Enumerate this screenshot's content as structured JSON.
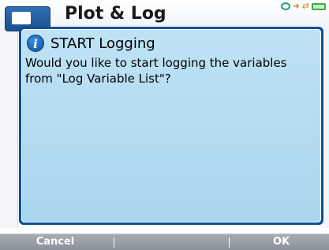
{
  "background": {
    "app_title": "Plot & Log"
  },
  "status_bar": {
    "icons": [
      "usb-connection-icon",
      "transfer-arrow-icon",
      "network-icon",
      "battery-icon"
    ]
  },
  "dialog": {
    "icon": "info-icon",
    "title": "START Logging",
    "message": "Would you like to start logging the variables from \"Log Variable List\"?"
  },
  "softkeys": {
    "left_label": "Cancel",
    "right_label": "OK"
  },
  "colors": {
    "dialog_border": "#0c4f95",
    "dialog_fill": "#b6dcf2",
    "softkey_bar": "#9aa0a7"
  }
}
